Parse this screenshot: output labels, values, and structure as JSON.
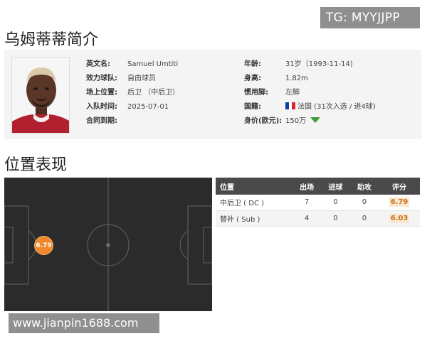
{
  "watermarks": {
    "tg": "TG: MYYJJPP",
    "url": "www.jianpin1688.com"
  },
  "profile": {
    "title": "乌姆蒂蒂简介",
    "fields_left": [
      {
        "label": "英文名:",
        "value": "Samuel Umtiti"
      },
      {
        "label": "效力球队:",
        "value": "自由球员"
      },
      {
        "label": "场上位置:",
        "value": "后卫 （中后卫）"
      },
      {
        "label": "入队时间:",
        "value": "2025-07-01"
      },
      {
        "label": "合同到期:",
        "value": ""
      }
    ],
    "fields_right": [
      {
        "label": "年龄:",
        "value": "31岁（1993-11-14)"
      },
      {
        "label": "身高:",
        "value": "1.82m"
      },
      {
        "label": "惯用脚:",
        "value": "左脚"
      },
      {
        "label": "国籍:",
        "value": "法国 (31次入选 / 进4球)"
      },
      {
        "label": "身价(欧元):",
        "value": "150万"
      }
    ],
    "nationality_flag": "france-flag-icon",
    "value_trend": "down",
    "trend_color": "#3b9a3b"
  },
  "position_section": {
    "title": "位置表现",
    "pitch_marker": {
      "rating": "6.79",
      "color": "#f0892a"
    }
  },
  "stats": {
    "headers": [
      "位置",
      "出场",
      "进球",
      "助攻",
      "评分"
    ],
    "rows": [
      {
        "position": "中后卫 ( DC )",
        "apps": "7",
        "goals": "0",
        "assists": "0",
        "rating": "6.79"
      },
      {
        "position": "替补 ( Sub )",
        "apps": "4",
        "goals": "0",
        "assists": "0",
        "rating": "6.03"
      }
    ]
  }
}
